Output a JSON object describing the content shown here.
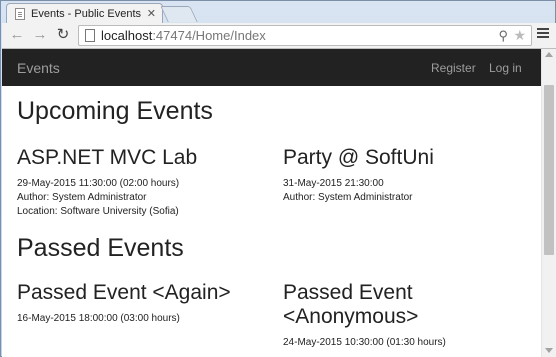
{
  "browser": {
    "tab_title": "Events - Public Events",
    "tab_close": "✕",
    "url_host": "localhost",
    "url_rest": ":47474/Home/Index"
  },
  "navbar": {
    "brand": "Events",
    "links": [
      "Register",
      "Log in"
    ]
  },
  "upcoming": {
    "heading": "Upcoming Events",
    "events": [
      {
        "title": "ASP.NET MVC Lab",
        "lines": [
          "29-May-2015 11:30:00 (02:00 hours)",
          "Author: System Administrator",
          "Location: Software University (Sofia)"
        ]
      },
      {
        "title": "Party @ SoftUni",
        "lines": [
          "31-May-2015 21:30:00",
          "Author: System Administrator"
        ]
      }
    ]
  },
  "passed": {
    "heading": "Passed Events",
    "events": [
      {
        "title": "Passed Event <Again>",
        "lines": [
          "16-May-2015 18:00:00 (03:00 hours)"
        ]
      },
      {
        "title": "Passed Event <Anonymous>",
        "lines": [
          "24-May-2015 10:30:00 (01:30 hours)"
        ]
      }
    ]
  }
}
